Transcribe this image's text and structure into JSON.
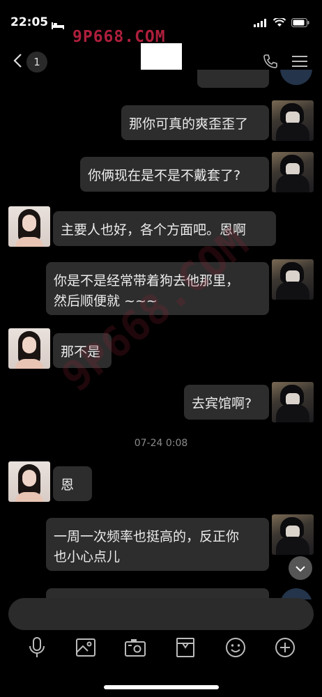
{
  "status": {
    "time": "22:05",
    "watermark": "9P668.COM"
  },
  "nav": {
    "back_count": "1"
  },
  "messages": [
    {
      "side": "right",
      "text": "那你可真的爽歪歪了"
    },
    {
      "side": "right",
      "text": "你俩现在是不是不戴套了?"
    },
    {
      "side": "left",
      "text": "主要人也好，各个方面吧。恩啊"
    },
    {
      "side": "right",
      "text": "你是不是经常带着狗去他那里，\n然后顺便就 ~~~"
    },
    {
      "side": "left",
      "text": "那不是"
    },
    {
      "side": "right",
      "text": "去宾馆啊?"
    },
    {
      "side": "left",
      "text": "恩"
    },
    {
      "side": "right",
      "text": "一周一次频率也挺高的，反正你\n也小心点儿"
    }
  ],
  "timestamp": "07-24 0:08",
  "diag_watermark": "9P668.COM",
  "toolbar": [
    "mic-icon",
    "image-icon",
    "camera-icon",
    "gift-icon",
    "emoji-icon",
    "plus-icon"
  ],
  "colors": {
    "background": "#000000",
    "bubble": "#2d2d2d",
    "watermark": "#ad1f3c"
  }
}
